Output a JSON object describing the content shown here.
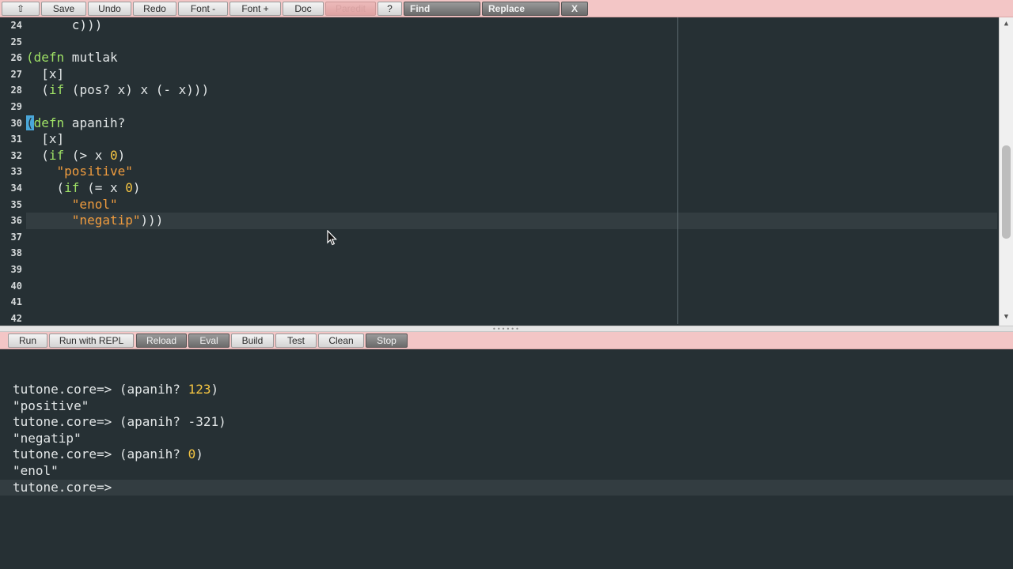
{
  "toolbar": {
    "buttons": [
      {
        "label": "⇧"
      },
      {
        "label": "Save"
      },
      {
        "label": "Undo"
      },
      {
        "label": "Redo"
      },
      {
        "label": "Font -"
      },
      {
        "label": "Font +"
      },
      {
        "label": "Doc"
      },
      {
        "label": "Paredit"
      },
      {
        "label": "?"
      },
      {
        "label": "Find"
      },
      {
        "label": "Replace"
      },
      {
        "label": "X"
      }
    ]
  },
  "editor": {
    "line_numbers": [
      "24",
      "25",
      "26",
      "27",
      "28",
      "29",
      "30",
      "31",
      "32",
      "33",
      "34",
      "35",
      "36",
      "37",
      "38",
      "39",
      "40",
      "41",
      "42"
    ],
    "current_line": "36"
  },
  "runbar": {
    "buttons": [
      {
        "label": "Run"
      },
      {
        "label": "Run with REPL"
      },
      {
        "label": "Reload"
      },
      {
        "label": "Eval"
      },
      {
        "label": "Build"
      },
      {
        "label": "Test"
      },
      {
        "label": "Clean"
      },
      {
        "label": "Stop"
      }
    ]
  },
  "repl": {
    "prompt": "tutone.core=> ",
    "lines": [
      {
        "call": "(apanih? ",
        "arg": "123",
        "close": ")"
      },
      {
        "result": "\"positive\""
      },
      {
        "call": "(apanih? -321)"
      },
      {
        "result": "\"negatip\""
      },
      {
        "call": "(apanih? ",
        "arg": "0",
        "close": ")"
      },
      {
        "result": "\"enol\""
      }
    ],
    "final_prompt": "tutone.core=>"
  },
  "colors": {
    "background": "#263034",
    "keyword": "#9fe266",
    "string": "#f09c3e",
    "number": "#f5c542",
    "toolbar": "#f3c6c6"
  }
}
